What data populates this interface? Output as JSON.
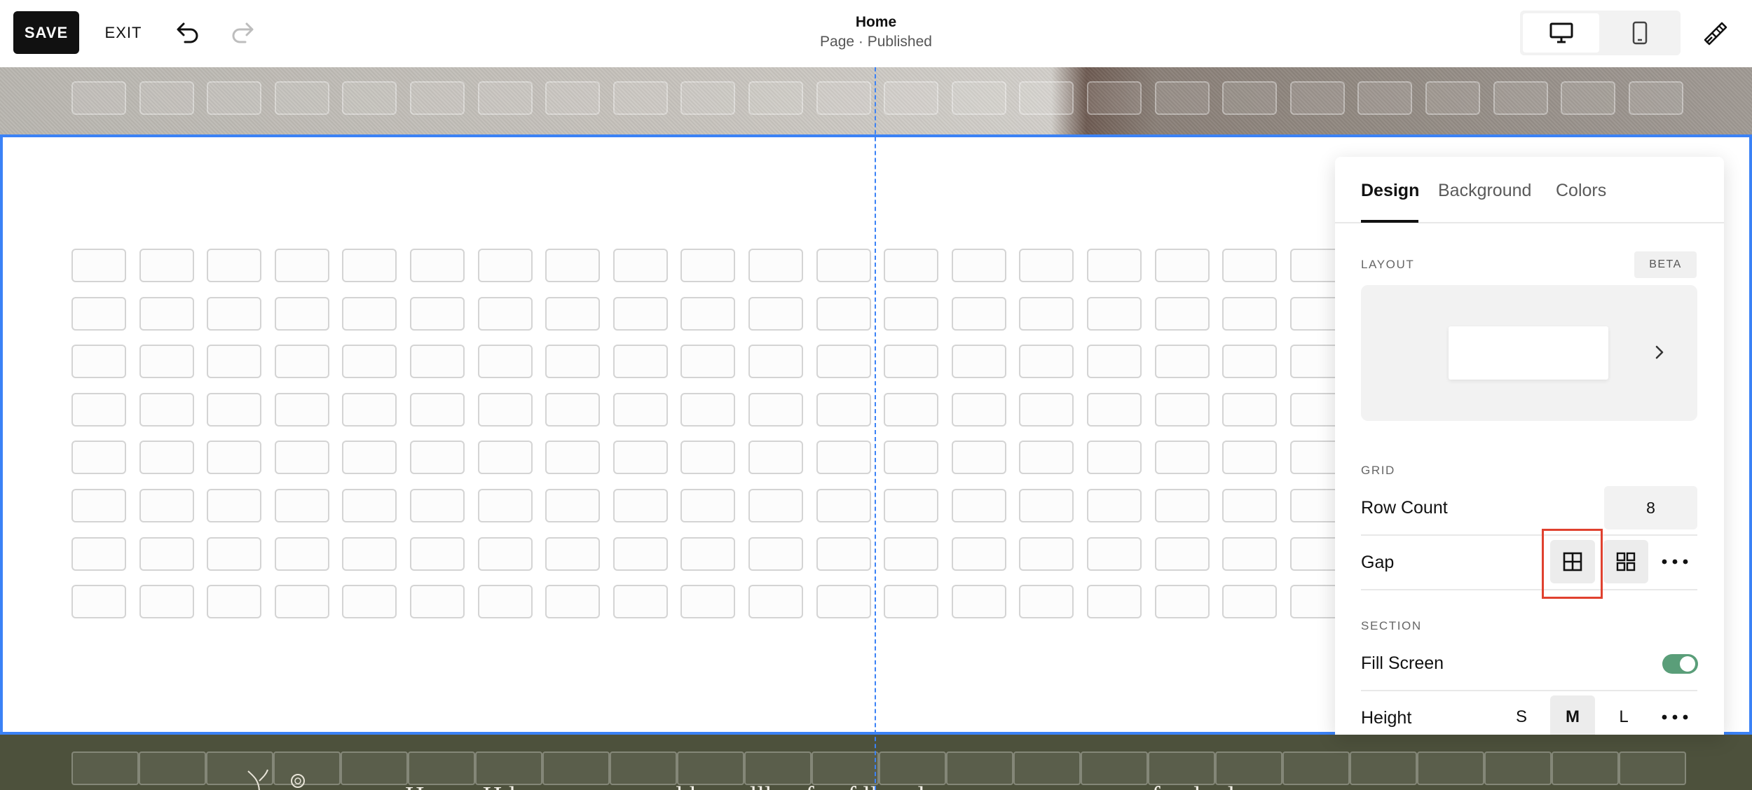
{
  "toolbar": {
    "save_label": "SAVE",
    "exit_label": "EXIT",
    "undo_icon": "undo-icon",
    "redo_icon": "redo-icon",
    "page_title": "Home",
    "page_status": "Page · Published",
    "device_options": [
      "desktop-icon",
      "mobile-icon"
    ],
    "selected_device": "desktop",
    "style_icon": "paintbrush-icon"
  },
  "canvas": {
    "grid_rows": 8,
    "grid_columns": 24,
    "footer_text": "Hen.... H.l........ ...... ...... .l.b..... .lll.....f.... f.ll.... .l.. ..... ..... .. ........ .. ... f... .l.. .l..."
  },
  "panel": {
    "tabs": [
      "Design",
      "Background",
      "Colors"
    ],
    "active_tab": "Design",
    "layout": {
      "label": "LAYOUT",
      "badge": "BETA"
    },
    "grid": {
      "label": "GRID",
      "row_count_label": "Row Count",
      "row_count_value": "8",
      "gap_label": "Gap",
      "gap_options": [
        "grid-gap-small-icon",
        "grid-gap-large-icon",
        "more-icon"
      ],
      "selected_gap": "grid-gap-small-icon"
    },
    "section": {
      "label": "SECTION",
      "fill_screen_label": "Fill Screen",
      "fill_screen_on": true,
      "height_label": "Height",
      "height_options": [
        "S",
        "M",
        "L"
      ],
      "selected_height": "M"
    }
  },
  "colors": {
    "accent": "#3b82f6",
    "toggle_on": "#5a9e79",
    "highlight": "#e0412f",
    "footer_bg": "#4d513c"
  }
}
